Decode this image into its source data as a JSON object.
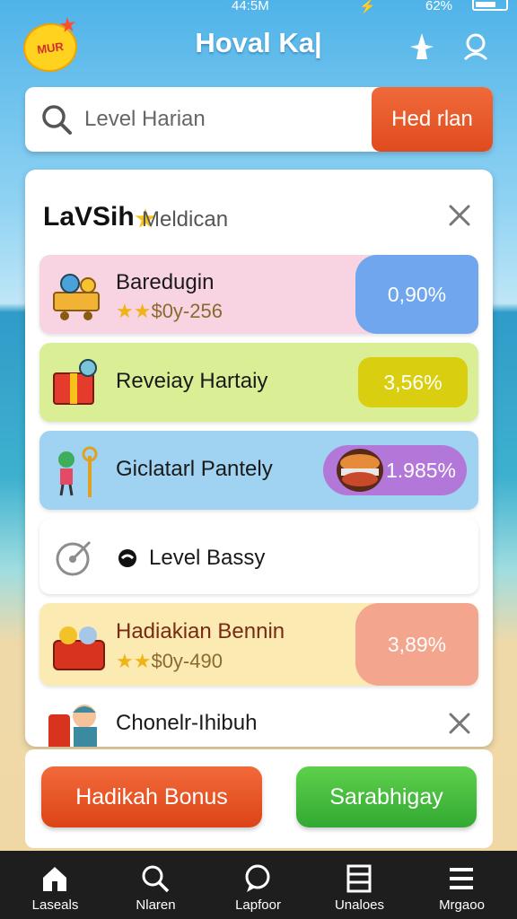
{
  "status": {
    "time": "44:5M",
    "battery": "62%"
  },
  "header": {
    "logo_text": "MUR",
    "title": "Hoval Ka|"
  },
  "search": {
    "placeholder": "Level Harian",
    "button": "Hed rlan"
  },
  "panel": {
    "title": "LaVSih",
    "subtitle": "Meldican",
    "rows": [
      {
        "name": "Baredugin",
        "stars": "★★",
        "detail": "$0y-256",
        "pct": "0,90%",
        "color": "#6fa6ee",
        "bg": "#f8d3e2"
      },
      {
        "name": "Reveiay Hartaiy",
        "pct": "3,56%",
        "color": "#d9cf10",
        "bg": "#d9ee95"
      },
      {
        "name": "Giclatarl Pantely",
        "pct": "1.985%",
        "color": "#b277d8",
        "bg": "#9fd3f1"
      },
      {
        "name": "Level Bassy"
      },
      {
        "name": "Hadiakian Bennin",
        "stars": "★★",
        "detail": "$0y-490",
        "pct": "3,89%",
        "color": "#f4a58e",
        "bg": "#fbeab1"
      },
      {
        "name": "Chonelr-Ihibuh"
      }
    ]
  },
  "actions": {
    "primary": "Hadikah Bonus",
    "secondary": "Sarabhigay"
  },
  "tabs": [
    {
      "label": "Laseals",
      "icon": "home-icon"
    },
    {
      "label": "Nlaren",
      "icon": "search-icon"
    },
    {
      "label": "Lapfoor",
      "icon": "chat-icon"
    },
    {
      "label": "Unaloes",
      "icon": "list-icon"
    },
    {
      "label": "Mrgaoo",
      "icon": "menu-icon"
    }
  ]
}
